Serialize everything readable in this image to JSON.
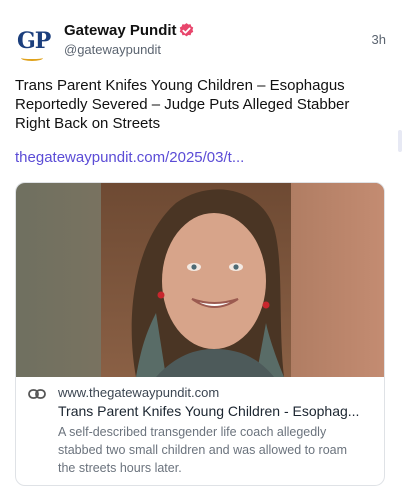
{
  "post": {
    "author_name": "Gateway Pundit",
    "handle": "@gatewaypundit",
    "time": "3h",
    "avatar_text": "GP",
    "text": "Trans Parent Knifes Young Children – Esophagus Reportedly Severed – Judge Puts Alleged Stabber Right Back on Streets",
    "link_text": "thegatewaypundit.com/2025/03/t...",
    "icons": {
      "verified": "verified-badge-icon",
      "link": "link-icon"
    },
    "colors": {
      "link": "#5b4cd6",
      "verified": "#e8466c",
      "avatar_blue": "#1c3f7d",
      "avatar_gold": "#e0a21c"
    }
  },
  "card": {
    "domain": "www.thegatewaypundit.com",
    "title": "Trans Parent Knifes Young Children - Esophag...",
    "description": "A self-described transgender life coach allegedly stabbed two small children and was allowed to roam the streets hours later."
  }
}
